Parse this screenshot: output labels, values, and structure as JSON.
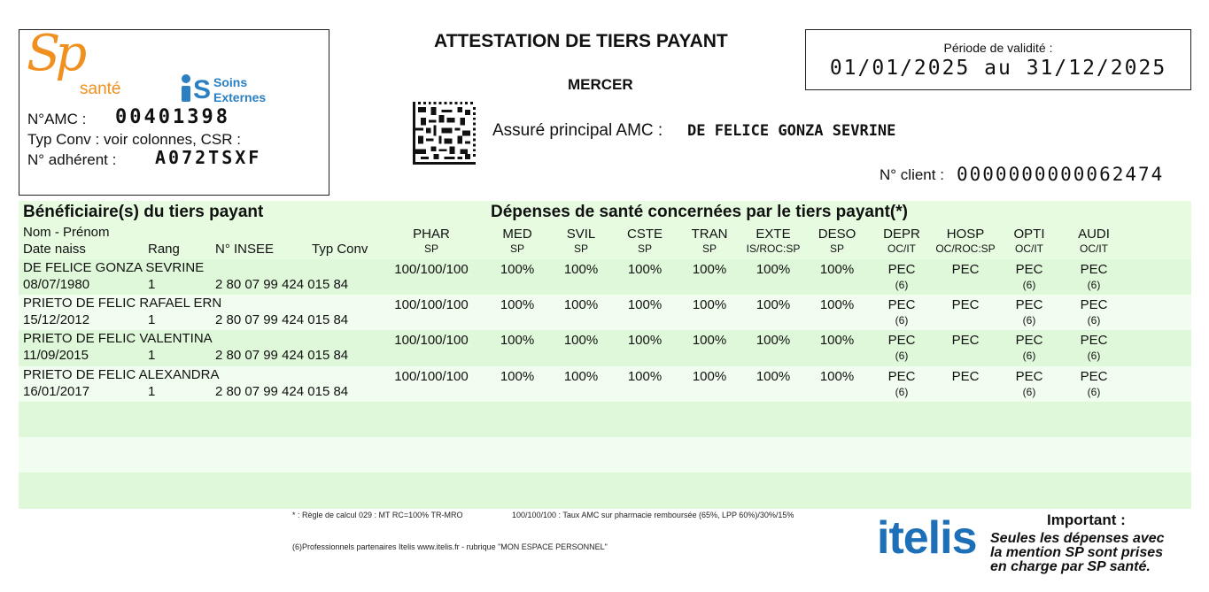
{
  "header": {
    "logo_sp": "Sp",
    "logo_sante": "santé",
    "logo_is_letter": "S",
    "logo_is_soins": "Soins",
    "logo_is_externes": "Externes",
    "amc_label": "N°AMC :",
    "amc_value": "00401398",
    "typ_conv": "Typ Conv : voir colonnes, CSR :",
    "adherent_label": "N° adhérent :",
    "adherent_value": "A072TSXF",
    "title": "ATTESTATION DE TIERS PAYANT",
    "org": "MERCER",
    "assure_label": "Assuré principal AMC :",
    "assure_name": "DE FELICE GONZA SEVRINE",
    "validity_label": "Période de validité :",
    "validity_dates": "01/01/2025 au 31/12/2025",
    "client_label": "N° client :",
    "client_value": "0000000000062474"
  },
  "table": {
    "left_title": "Bénéficiaire(s) du tiers payant",
    "right_title": "Dépenses de santé concernées par le tiers payant(*)",
    "col_nom": "Nom - Prénom",
    "col_date": "Date naiss",
    "col_rang": "Rang",
    "col_insee": "N° INSEE",
    "col_typconv": "Typ Conv",
    "columns": [
      {
        "code": "PHAR",
        "sub": "SP"
      },
      {
        "code": "MED",
        "sub": "SP"
      },
      {
        "code": "SVIL",
        "sub": "SP"
      },
      {
        "code": "CSTE",
        "sub": "SP"
      },
      {
        "code": "TRAN",
        "sub": "SP"
      },
      {
        "code": "EXTE",
        "sub": "IS/ROC:SP"
      },
      {
        "code": "DESO",
        "sub": "SP"
      },
      {
        "code": "DEPR",
        "sub": "OC/IT"
      },
      {
        "code": "HOSP",
        "sub": "OC/ROC:SP"
      },
      {
        "code": "OPTI",
        "sub": "OC/IT"
      },
      {
        "code": "AUDI",
        "sub": "OC/IT"
      }
    ],
    "rows": [
      {
        "name": "DE FELICE GONZA SEVRINE",
        "date": "08/07/1980",
        "rang": "1",
        "insee": "2 80 07 99 424 015 84",
        "vals": [
          "100/100/100",
          "100%",
          "100%",
          "100%",
          "100%",
          "100%",
          "100%",
          "PEC",
          "PEC",
          "PEC",
          "PEC"
        ],
        "notes": [
          "",
          "",
          "",
          "",
          "",
          "",
          "",
          "(6)",
          "",
          "(6)",
          "(6)"
        ]
      },
      {
        "name": "PRIETO DE FELIC RAFAEL ERN",
        "date": "15/12/2012",
        "rang": "1",
        "insee": "2 80 07 99 424 015 84",
        "vals": [
          "100/100/100",
          "100%",
          "100%",
          "100%",
          "100%",
          "100%",
          "100%",
          "PEC",
          "PEC",
          "PEC",
          "PEC"
        ],
        "notes": [
          "",
          "",
          "",
          "",
          "",
          "",
          "",
          "(6)",
          "",
          "(6)",
          "(6)"
        ]
      },
      {
        "name": "PRIETO DE FELIC VALENTINA",
        "date": "11/09/2015",
        "rang": "1",
        "insee": "2 80 07 99 424 015 84",
        "vals": [
          "100/100/100",
          "100%",
          "100%",
          "100%",
          "100%",
          "100%",
          "100%",
          "PEC",
          "PEC",
          "PEC",
          "PEC"
        ],
        "notes": [
          "",
          "",
          "",
          "",
          "",
          "",
          "",
          "(6)",
          "",
          "(6)",
          "(6)"
        ]
      },
      {
        "name": "PRIETO DE FELIC ALEXANDRA",
        "date": "16/01/2017",
        "rang": "1",
        "insee": "2 80 07 99 424 015 84",
        "vals": [
          "100/100/100",
          "100%",
          "100%",
          "100%",
          "100%",
          "100%",
          "100%",
          "PEC",
          "PEC",
          "PEC",
          "PEC"
        ],
        "notes": [
          "",
          "",
          "",
          "",
          "",
          "",
          "",
          "(6)",
          "",
          "(6)",
          "(6)"
        ]
      }
    ]
  },
  "footer": {
    "note1": "* : Règle de calcul 029 : MT RC=100% TR-MRO",
    "note2": "100/100/100 : Taux AMC sur pharmacie remboursée (65%, LPP 60%)/30%/15%",
    "note3": "(6)Professionnels partenaires Itelis www.itelis.fr - rubrique \"MON ESPACE PERSONNEL\"",
    "logo_itelis": "itelis",
    "important_title": "Important :",
    "important_line1": "Seules les dépenses avec",
    "important_line2": "la mention SP sont prises",
    "important_line3": "en charge par SP santé."
  }
}
